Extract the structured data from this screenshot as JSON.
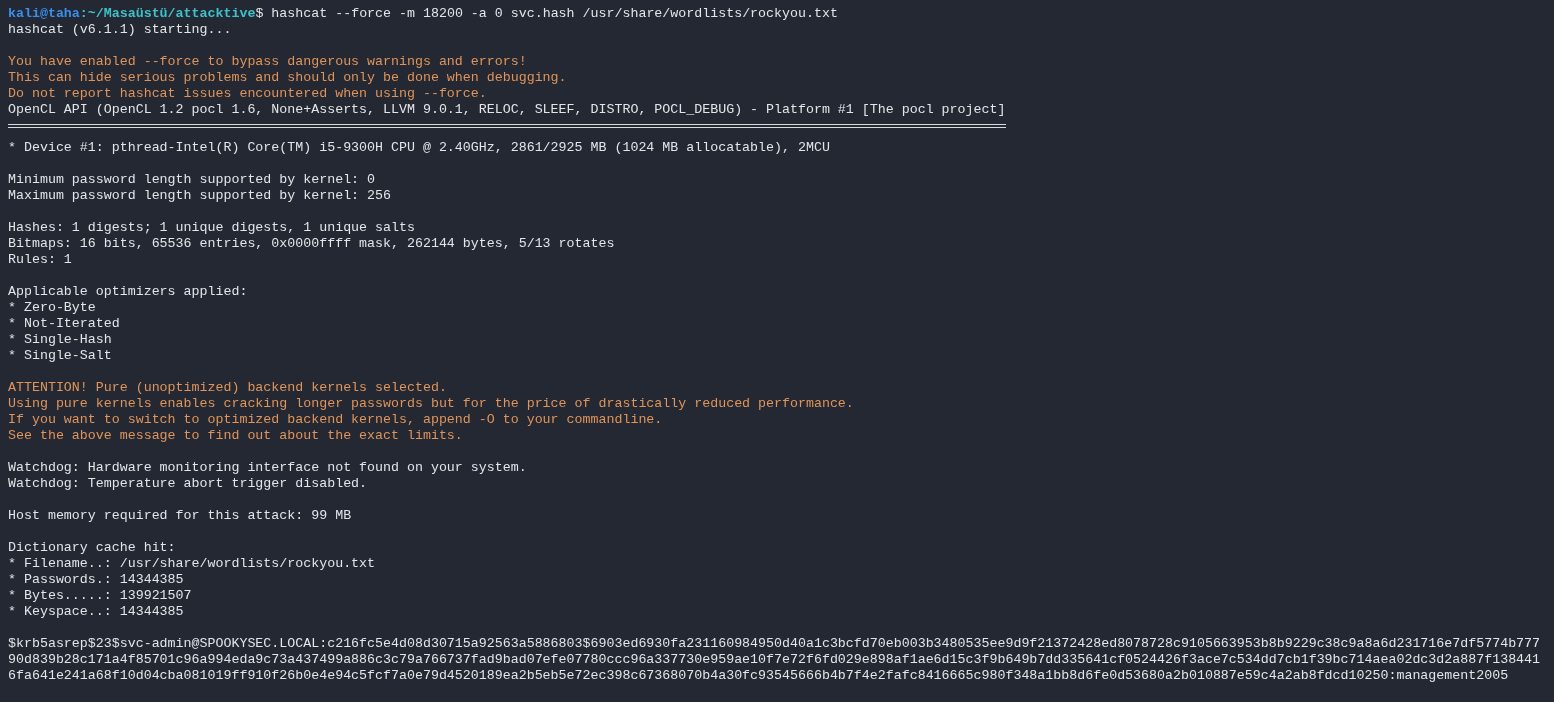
{
  "terminal": {
    "lines": [
      {
        "kind": "prompt",
        "user_host": "kali@taha",
        "path": ":~/Masaüstü/attacktive",
        "symbol": "$",
        "command": " hashcat --force -m 18200 -a 0 svc.hash /usr/share/wordlists/rockyou.txt"
      },
      {
        "kind": "output",
        "text": "hashcat (v6.1.1) starting..."
      },
      {
        "kind": "blank"
      },
      {
        "kind": "warning",
        "text": "You have enabled --force to bypass dangerous warnings and errors!"
      },
      {
        "kind": "warning",
        "text": "This can hide serious problems and should only be done when debugging."
      },
      {
        "kind": "warning",
        "text": "Do not report hashcat issues encountered when using --force."
      },
      {
        "kind": "output",
        "text": "OpenCL API (OpenCL 1.2 pocl 1.6, None+Asserts, LLVM 9.0.1, RELOC, SLEEF, DISTRO, POCL_DEBUG) - Platform #1 [The pocl project]"
      },
      {
        "kind": "rule"
      },
      {
        "kind": "output",
        "text": "* Device #1: pthread-Intel(R) Core(TM) i5-9300H CPU @ 2.40GHz, 2861/2925 MB (1024 MB allocatable), 2MCU"
      },
      {
        "kind": "blank"
      },
      {
        "kind": "output",
        "text": "Minimum password length supported by kernel: 0"
      },
      {
        "kind": "output",
        "text": "Maximum password length supported by kernel: 256"
      },
      {
        "kind": "blank"
      },
      {
        "kind": "output",
        "text": "Hashes: 1 digests; 1 unique digests, 1 unique salts"
      },
      {
        "kind": "output",
        "text": "Bitmaps: 16 bits, 65536 entries, 0x0000ffff mask, 262144 bytes, 5/13 rotates"
      },
      {
        "kind": "output",
        "text": "Rules: 1"
      },
      {
        "kind": "blank"
      },
      {
        "kind": "output",
        "text": "Applicable optimizers applied:"
      },
      {
        "kind": "output",
        "text": "* Zero-Byte"
      },
      {
        "kind": "output",
        "text": "* Not-Iterated"
      },
      {
        "kind": "output",
        "text": "* Single-Hash"
      },
      {
        "kind": "output",
        "text": "* Single-Salt"
      },
      {
        "kind": "blank"
      },
      {
        "kind": "warning",
        "text": "ATTENTION! Pure (unoptimized) backend kernels selected."
      },
      {
        "kind": "warning",
        "text": "Using pure kernels enables cracking longer passwords but for the price of drastically reduced performance."
      },
      {
        "kind": "warning",
        "text": "If you want to switch to optimized backend kernels, append -O to your commandline."
      },
      {
        "kind": "warning",
        "text": "See the above message to find out about the exact limits."
      },
      {
        "kind": "blank"
      },
      {
        "kind": "output",
        "text": "Watchdog: Hardware monitoring interface not found on your system."
      },
      {
        "kind": "output",
        "text": "Watchdog: Temperature abort trigger disabled."
      },
      {
        "kind": "blank"
      },
      {
        "kind": "output",
        "text": "Host memory required for this attack: 99 MB"
      },
      {
        "kind": "blank"
      },
      {
        "kind": "output",
        "text": "Dictionary cache hit:"
      },
      {
        "kind": "output",
        "text": "* Filename..: /usr/share/wordlists/rockyou.txt"
      },
      {
        "kind": "output",
        "text": "* Passwords.: 14344385"
      },
      {
        "kind": "output",
        "text": "* Bytes.....: 139921507"
      },
      {
        "kind": "output",
        "text": "* Keyspace..: 14344385"
      },
      {
        "kind": "blank"
      },
      {
        "kind": "output",
        "text": "$krb5asrep$23$svc-admin@SPOOKYSEC.LOCAL:c216fc5e4d08d30715a92563a5886803$6903ed6930fa231160984950d40a1c3bcfd70eb003b3480535ee9d9f21372428ed8078728c9105663953b8b9229c38c9a8a6d231716e7df5774b777"
      },
      {
        "kind": "output",
        "text": "90d839b28c171a4f85701c96a994eda9c73a437499a886c3c79a766737fad9bad07efe07780ccc96a337730e959ae10f7e72f6fd029e898af1ae6d15c3f9b649b7dd335641cf0524426f3ace7c534dd7cb1f39bc714aea02dc3d2a887f138441"
      },
      {
        "kind": "output",
        "text": "6fa641e241a68f10d04cba081019ff910f26b0e4e94c5fcf7a0e79d4520189ea2b5eb5e72ec398c67368070b4a30fc93545666b4b7f4e2fafc8416665c980f348a1bb8d6fe0d53680a2b010887e59c4a2ab8fdcd10250:management2005"
      }
    ]
  }
}
